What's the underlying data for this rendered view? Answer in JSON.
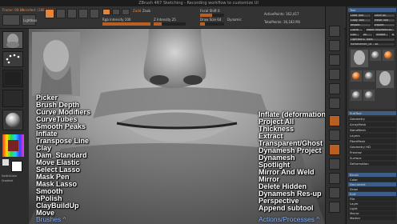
{
  "app": {
    "title": "ZBrush 4R7 Sketching - Recording workflow to customize UI"
  },
  "top": {
    "frame_info": "Frame: 00:19",
    "rec_info": "recorded: (186,0000)",
    "tool_prefix": "Tool",
    "lightbox": "Lightbox",
    "zadd": "Zadd",
    "zsub": "Zsub",
    "zintensity": "Z Intensity 25",
    "rgb_intensity": "Rgb Intensity 100",
    "focal_shift": "Focal Shift 0",
    "draw_size": "Draw Size 64",
    "dynamic": "Dynamic",
    "active_points": "ActivePoints: 162,417",
    "total_points": "TotalPoints: 16,183 Mil"
  },
  "left_menu": [
    "Picker",
    "Brush Depth",
    "Curve Modifiers",
    "CurveTubes",
    "Smooth Peaks",
    "Inflate",
    "Transpose Line",
    "Clay",
    "Dam_Standard",
    "Move Elastic",
    "Select Lasso",
    "Mask Pen",
    "Mask Lasso",
    "Smooth",
    "hPolish",
    "ClayBuildUp",
    "Move"
  ],
  "right_menu": [
    "Inflate (deformation)",
    "Project All",
    "Thickness",
    "Extract",
    "Transparent/Ghost",
    "Dynamesh Project",
    "Dynamesh",
    "Spotlight",
    "Mirror And Weld",
    "Mirror",
    "Delete Hidden",
    "Dynamesh Res-up",
    "Perspective",
    "Append subtool"
  ],
  "footer": {
    "brushes": "Brushes ^",
    "actions": "Actions/Processes ^"
  },
  "panel": {
    "header": "Tool",
    "load_tool": "Load Tool",
    "save_as": "Save As",
    "copy_tool": "Copy Tool",
    "paste_tool": "Paste Tool",
    "import": "Import",
    "export": "Export",
    "clone": "Clone",
    "make_polymesh": "Make PolyMesh3D",
    "goz": "GoZ",
    "all": "All",
    "visible": "Visible",
    "r": "R",
    "lightbox_tools": "Lightbox ▸ Tools",
    "tool_name": "Rafaelwhite_0k - 48",
    "subtool": "SubTool",
    "geometry": "Geometry",
    "arraymesh": "ArrayMesh",
    "nanomesh": "NanoMesh",
    "layers": "Layers",
    "fibermesh": "FiberMesh",
    "geometry_hd": "Geometry HD",
    "preview": "Preview",
    "surface": "Surface",
    "deformation": "Deformation",
    "menu_items": [
      "Brush",
      "Color",
      "Document",
      "Draw",
      "Edit",
      "File",
      "Layer",
      "Light",
      "Macro",
      "Marker"
    ]
  },
  "left_panel": {
    "simple_brush": "SimpleBrush",
    "gradient": "Gradient",
    "switch_color": "SwitchColor",
    "alternate": "Alternate"
  },
  "colors": {
    "accent": "#e8833a",
    "footer_text": "#7fb0ff",
    "section_blue": "#3d5e86"
  }
}
